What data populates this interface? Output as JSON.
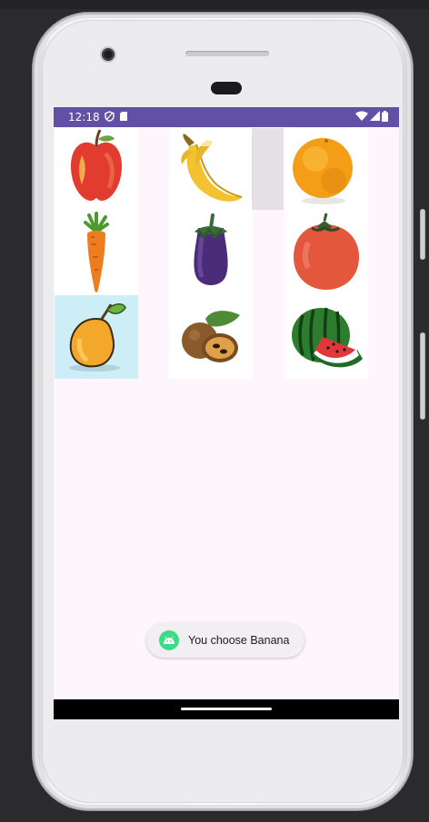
{
  "status_bar": {
    "time": "12:18",
    "icons": [
      "vpn-shield-icon",
      "sd-card-icon",
      "wifi-icon",
      "cell-signal-icon",
      "battery-icon"
    ],
    "background": "#6250a6"
  },
  "grid": {
    "items": [
      {
        "icon": "apple-icon",
        "selected": false
      },
      {
        "icon": "banana-icon",
        "selected": false
      },
      {
        "icon": "orange-icon",
        "selected": false
      },
      {
        "icon": "carrot-icon",
        "selected": false
      },
      {
        "icon": "eggplant-icon",
        "selected": false
      },
      {
        "icon": "tomato-icon",
        "selected": false
      },
      {
        "icon": "mango-icon",
        "selected": true
      },
      {
        "icon": "sapodilla-icon",
        "selected": false
      },
      {
        "icon": "watermelon-icon",
        "selected": false
      }
    ]
  },
  "toast": {
    "message": "You choose Banana",
    "icon": "android-app-icon"
  },
  "colors": {
    "screen_background": "#fdf7fd",
    "selected_cell": "#cdeef7",
    "toast_icon": "#3ddc84"
  }
}
